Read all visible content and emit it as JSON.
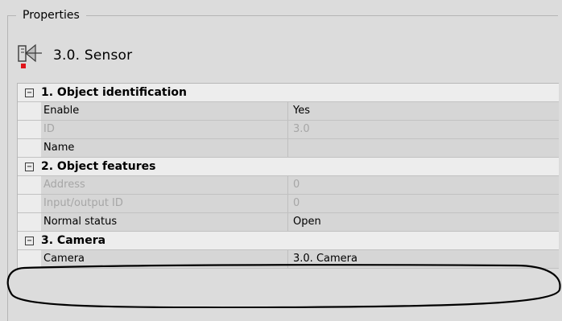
{
  "panel": {
    "title": "Properties"
  },
  "object": {
    "name": "3.0. Sensor",
    "icon": "sensor-icon"
  },
  "sections": [
    {
      "title": "1. Object identification",
      "toggle": "−",
      "rows": [
        {
          "name": "Enable",
          "value": "Yes",
          "disabled": false
        },
        {
          "name": "ID",
          "value": "3.0",
          "disabled": true
        },
        {
          "name": "Name",
          "value": "",
          "disabled": false
        }
      ]
    },
    {
      "title": "2. Object features",
      "toggle": "−",
      "rows": [
        {
          "name": "Address",
          "value": "0",
          "disabled": true
        },
        {
          "name": "Input/output ID",
          "value": "0",
          "disabled": true
        },
        {
          "name": "Normal status",
          "value": "Open",
          "disabled": false
        }
      ]
    },
    {
      "title": "3. Camera",
      "toggle": "−",
      "rows": [
        {
          "name": "Camera",
          "value": "3.0. Camera",
          "disabled": false
        }
      ]
    }
  ],
  "colors": {
    "background": "#dcdcdc",
    "marker": "#e0141a",
    "annotation": "#000000"
  }
}
